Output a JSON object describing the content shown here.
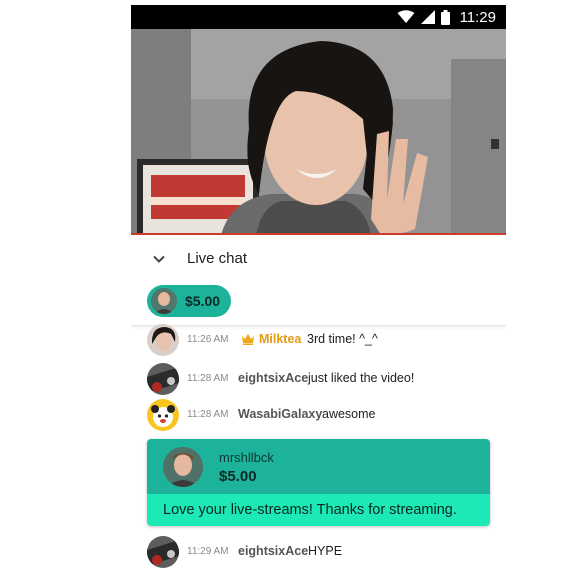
{
  "status_bar": {
    "time": "11:29",
    "icons": [
      "wifi-icon",
      "signal-icon",
      "battery-icon"
    ]
  },
  "video": {
    "description": "live stream video frame"
  },
  "chat_header": {
    "title": "Live chat",
    "collapse_icon": "chevron-down-icon"
  },
  "ticker": {
    "amount": "$5.00"
  },
  "messages": [
    {
      "time": "11:26 AM",
      "author": "Milktea",
      "text": "3rd time! ^_^",
      "badge": "crown-icon"
    },
    {
      "time": "11:28 AM",
      "author": "eightsixAce",
      "text": "just liked the video!"
    },
    {
      "time": "11:28 AM",
      "author": "WasabiGalaxy",
      "text": "awesome"
    },
    {
      "time": "11:29 AM",
      "author": "eightsixAce",
      "text": "HYPE"
    }
  ],
  "super_chat": {
    "author": "mrshllbck",
    "amount": "$5.00",
    "message": "Love your live-streams! Thanks for streaming."
  },
  "colors": {
    "accent": "#1db39a",
    "accent_light": "#1de9b6",
    "owner": "#e59b12",
    "video_line": "#cc3a2a"
  }
}
